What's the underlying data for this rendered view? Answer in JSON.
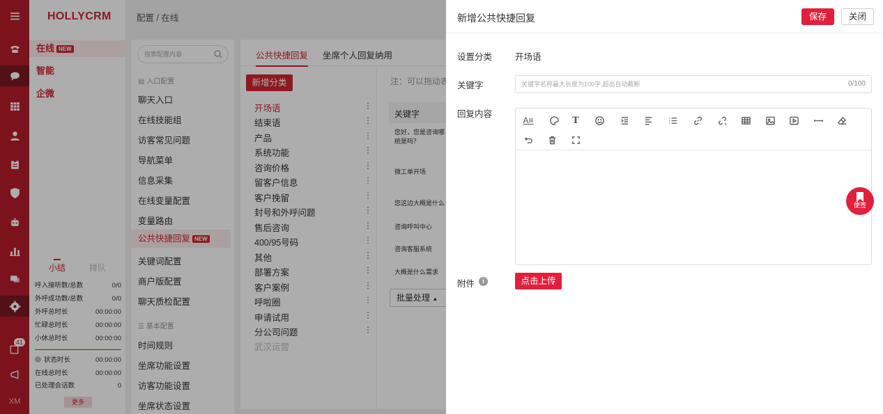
{
  "rail": {
    "badge_count": "41",
    "bottom_label": "XM"
  },
  "nav": {
    "brand": "HOLLYCRM",
    "items": [
      {
        "label": "在线",
        "badge": "NEW"
      },
      {
        "label": "智能"
      },
      {
        "label": "企微"
      }
    ],
    "stat_tabs": [
      "小结",
      "排队"
    ],
    "stats": [
      {
        "label": "呼入接听数/总数",
        "value": "0/0"
      },
      {
        "label": "外呼成功数/总数",
        "value": "0/0"
      },
      {
        "label": "外呼总时长",
        "value": "00:00:00"
      },
      {
        "label": "忙碌总时长",
        "value": "00:00:00"
      },
      {
        "label": "小休总时长",
        "value": "00:00:00"
      },
      {
        "label": "状态时长",
        "value": "00:00:00"
      },
      {
        "label": "在线总时长",
        "value": "00:00:00"
      },
      {
        "label": "已处理会话数",
        "value": "0"
      }
    ],
    "more": "更多"
  },
  "breadcrumb": "配置 / 在线",
  "submenu": {
    "search_placeholder": "搜索配置内容",
    "group1": "入口配置",
    "group1_items": [
      "聊天入口",
      "在线技能组",
      "访客常见问题",
      "导航菜单",
      "信息采集",
      "在线变量配置",
      "变量路由",
      "公共快捷回复",
      "关键词配置",
      "商户版配置",
      "聊天质检配置"
    ],
    "active_badge": "NEW",
    "group2": "基本配置",
    "group2_items": [
      "时间规则",
      "坐席功能设置",
      "访客功能设置",
      "坐席状态设置"
    ]
  },
  "middle": {
    "tabs": [
      "公共快捷回复",
      "坐席个人回复纳用"
    ],
    "add_category": "新增分类",
    "note": "注：可以拖动表",
    "categories": [
      "开场语",
      "结束语",
      "产品",
      "系统功能",
      "咨询价格",
      "留客户信息",
      "客户挽留",
      "封号和外呼问题",
      "售后咨询",
      "400/95号码",
      "其他",
      "部署方案",
      "客户案例",
      "呼啦圈",
      "申请试用",
      "分公司问题",
      "武汉运营"
    ],
    "table_header": "关键字",
    "table_rows": [
      "您好，您是咨询哪统是吗？",
      "微工单开场",
      "您这边大概是什么",
      "咨询呼叫中心",
      "咨询客服系统",
      "大概是什么需求"
    ],
    "batch": "批量处理"
  },
  "drawer": {
    "title": "新增公共快捷回复",
    "save": "保存",
    "close": "关闭",
    "category_label": "设置分类",
    "category_value": "开场语",
    "keyword_label": "关键字",
    "keyword_placeholder": "关键字名称最大长度为100字,超出自动截断",
    "keyword_count": "0/100",
    "content_label": "回复内容",
    "attachment_label": "附件",
    "upload": "点击上传"
  },
  "sticky": "便签",
  "colors": {
    "brand_red": "#d0262f",
    "rail": "#b71c2a",
    "drawer_red": "#e0203d"
  }
}
